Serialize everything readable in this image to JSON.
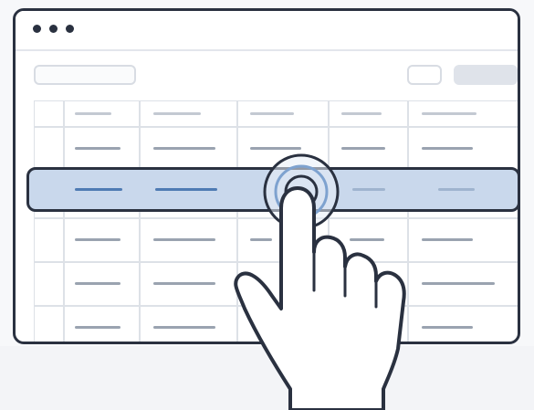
{
  "colors": {
    "outline": "#2a3140",
    "selection": "#c9d8ec",
    "selection_accent": "#4f7bb3",
    "ripple": "#7ea2cf",
    "grid": "#dde1e7"
  },
  "icons": {
    "window_controls": [
      "dot-icon",
      "dot-icon",
      "dot-icon"
    ],
    "pointer": "hand-pointer-icon",
    "tap_effect": "tap-ripple-icon"
  },
  "table": {
    "columns": 6,
    "rows": 6,
    "selected_row_index": 2
  }
}
